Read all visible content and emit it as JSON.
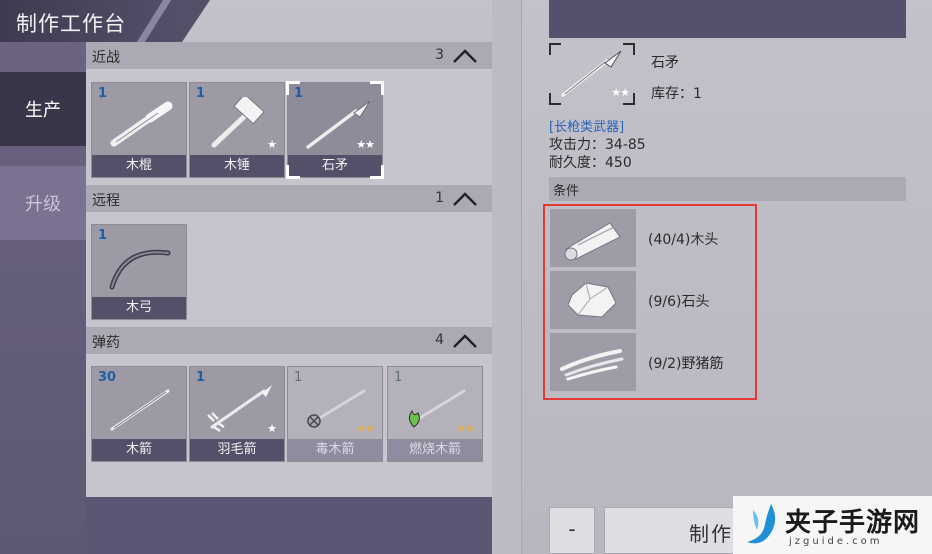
{
  "title": "制作工作台",
  "tabs": [
    {
      "label": "生产",
      "active": true
    },
    {
      "label": "升级",
      "active": false
    }
  ],
  "sections": [
    {
      "label": "近战",
      "count": "3",
      "items": [
        {
          "qty": "1",
          "name": "木棍",
          "stars": "",
          "icon": "wooden-stick-icon"
        },
        {
          "qty": "1",
          "name": "木锤",
          "stars": "★",
          "icon": "wooden-hammer-icon"
        },
        {
          "qty": "1",
          "name": "石矛",
          "stars": "★★",
          "icon": "stone-spear-icon",
          "selected": true
        }
      ]
    },
    {
      "label": "远程",
      "count": "1",
      "items": [
        {
          "qty": "1",
          "name": "木弓",
          "stars": "",
          "icon": "wooden-bow-icon"
        }
      ]
    },
    {
      "label": "弹药",
      "count": "4",
      "items": [
        {
          "qty": "30",
          "name": "木箭",
          "stars": "",
          "icon": "wooden-arrow-icon"
        },
        {
          "qty": "1",
          "name": "羽毛箭",
          "stars": "★",
          "icon": "feather-arrow-icon"
        },
        {
          "qty": "1",
          "name": "毒木箭",
          "stars": "★★",
          "icon": "poison-arrow-icon",
          "dim": true
        },
        {
          "qty": "1",
          "name": "燃烧木箭",
          "stars": "★★",
          "icon": "fire-arrow-icon",
          "dim": true
        }
      ]
    }
  ],
  "detail": {
    "name": "石矛",
    "stars": "★★",
    "stock": "库存：1",
    "type": "[长枪类武器]",
    "attack": "攻击力：34-85",
    "durability": "耐久度：450",
    "conditions_label": "条件",
    "materials": [
      {
        "text": "(40/4)木头",
        "icon": "wood-log-icon"
      },
      {
        "text": "(9/6)石头",
        "icon": "stone-icon"
      },
      {
        "text": "(9/2)野猪筋",
        "icon": "boar-sinew-icon"
      }
    ],
    "minus_label": "-",
    "craft_label": "制作"
  },
  "watermark": {
    "cn": "夹子手游网",
    "en": "jzguide.com"
  },
  "colors": {
    "accent_blue": "#1e5ea8",
    "highlight_red": "#e23a33",
    "tab_active": "#3b3549"
  }
}
